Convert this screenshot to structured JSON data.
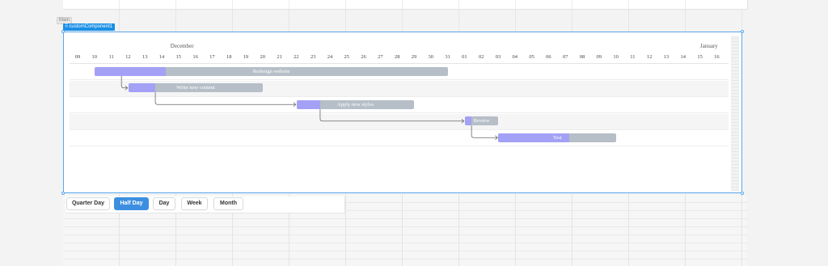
{
  "canvas": {
    "container_tag": "Main",
    "component_label": "customComponent1"
  },
  "gantt": {
    "months": [
      {
        "label": "December"
      },
      {
        "label": "January"
      }
    ],
    "days": [
      "09",
      "10",
      "11",
      "12",
      "13",
      "14",
      "15",
      "16",
      "17",
      "18",
      "19",
      "20",
      "21",
      "22",
      "23",
      "24",
      "25",
      "26",
      "27",
      "28",
      "29",
      "30",
      "31",
      "01",
      "02",
      "03",
      "04",
      "05",
      "06",
      "07",
      "08",
      "09",
      "10",
      "11",
      "12",
      "13",
      "14",
      "15",
      "16"
    ],
    "tasks": [
      {
        "name": "Redesign website",
        "start": "2012-12-10",
        "end": "2012-12-31",
        "progress": 20
      },
      {
        "name": "Write new content",
        "start": "2012-12-12",
        "end": "2012-12-20",
        "progress": 20
      },
      {
        "name": "Apply new styles",
        "start": "2012-12-22",
        "end": "2012-12-29",
        "progress": 20
      },
      {
        "name": "Review",
        "start": "2013-01-01",
        "end": "2013-01-03",
        "progress": 20
      },
      {
        "name": "Test",
        "start": "2013-01-03",
        "end": "2013-01-10",
        "progress": 60
      }
    ],
    "colors": {
      "bar": "#b6bec7",
      "progress": "#a3a1f5",
      "arrow": "#666666"
    }
  },
  "view_modes": {
    "buttons": [
      "Quarter Day",
      "Half Day",
      "Day",
      "Week",
      "Month"
    ],
    "active": "Half Day"
  },
  "selection_color": "#1a8fe6"
}
